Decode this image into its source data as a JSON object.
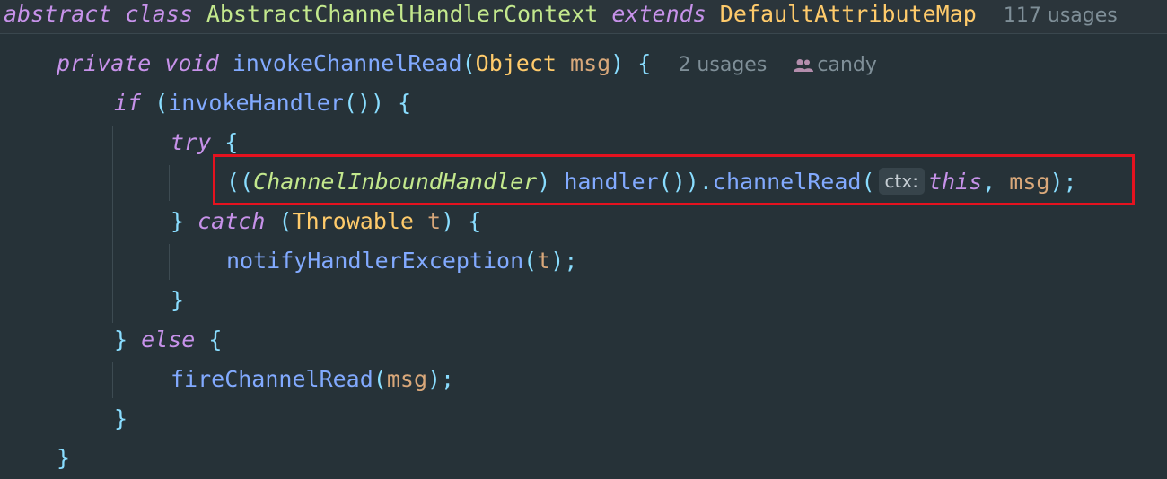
{
  "header": {
    "kw_abstract": "abstract",
    "kw_class": "class",
    "class_name": "AbstractChannelHandlerContext",
    "kw_extends": "extends",
    "parent_class": "DefaultAttributeMap",
    "usages": "117 usages"
  },
  "method": {
    "kw_private": "private",
    "kw_void": "void",
    "name": "invokeChannelRead",
    "param_type": "Object",
    "param_name": "msg",
    "usages": "2 usages",
    "author_icon": "people-icon",
    "author": "candy"
  },
  "body": {
    "kw_if": "if",
    "call_invoke_handler": "invokeHandler",
    "kw_try": "try",
    "cast_type": "ChannelInboundHandler",
    "call_handler": "handler",
    "call_channel_read": "channelRead",
    "inlay_ctx": "ctx:",
    "kw_this": "this",
    "arg_msg": "msg",
    "kw_catch": "catch",
    "catch_type": "Throwable",
    "catch_var": "t",
    "call_notify": "notifyHandlerException",
    "notify_arg": "t",
    "kw_else": "else",
    "call_fire": "fireChannelRead",
    "fire_arg": "msg"
  },
  "colors": {
    "background": "#263238",
    "keyword": "#c792ea",
    "function": "#82aaff",
    "type": "#ffcb6b",
    "class_name": "#c3e88d",
    "parameter": "#d9a87a",
    "punctuation": "#89ddff",
    "highlight_box": "#e5121f"
  }
}
